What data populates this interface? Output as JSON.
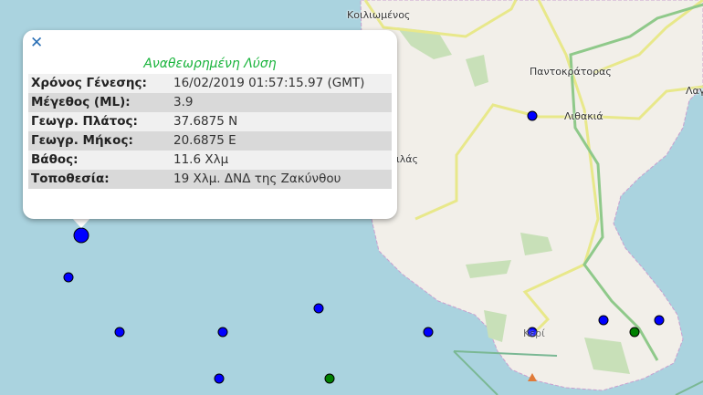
{
  "map": {
    "places": [
      "Κοιλιωμένος",
      "Παντοκράτορας",
      "Λιθακιά",
      "Λαγ",
      "ιλάς",
      "Κερί"
    ],
    "colors": {
      "sea": "#aad3df",
      "land": "#f2efe9",
      "event": "#0000ff",
      "station": "#008000",
      "marker": "#e07b39"
    }
  },
  "popup": {
    "close_icon": "close-icon",
    "title": "Αναθεωρημένη Λύση",
    "rows": [
      {
        "label": "Χρόνος Γένεσης:",
        "value": "16/02/2019 01:57:15.97 (GMT)"
      },
      {
        "label": "Μέγεθος (ML):",
        "value": "3.9"
      },
      {
        "label": "Γεωγρ. Πλάτος:",
        "value": "37.6875 N"
      },
      {
        "label": "Γεωγρ. Μήκος:",
        "value": "20.6875 E"
      },
      {
        "label": "Βάθος:",
        "value": "11.6 Χλμ"
      },
      {
        "label": "Τοποθεσία:",
        "value": "19 Χλμ. ΔΝΔ της Ζακύνθου"
      }
    ]
  }
}
